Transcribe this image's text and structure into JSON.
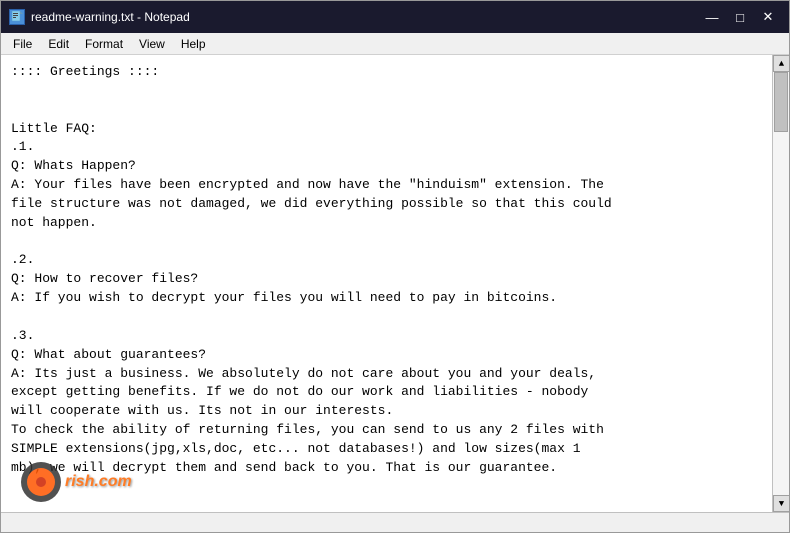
{
  "window": {
    "title": "readme-warning.txt - Notepad",
    "icon": "📄"
  },
  "titlebar": {
    "minimize_label": "—",
    "maximize_label": "□",
    "close_label": "✕"
  },
  "menubar": {
    "items": [
      "File",
      "Edit",
      "Format",
      "View",
      "Help"
    ]
  },
  "content": {
    "text": ":::: Greetings ::::\n\n\nLittle FAQ:\n.1.\nQ: Whats Happen?\nA: Your files have been encrypted and now have the \"hinduism\" extension. The\nfile structure was not damaged, we did everything possible so that this could\nnot happen.\n\n.2.\nQ: How to recover files?\nA: If you wish to decrypt your files you will need to pay in bitcoins.\n\n.3.\nQ: What about guarantees?\nA: Its just a business. We absolutely do not care about you and your deals,\nexcept getting benefits. If we do not do our work and liabilities - nobody\nwill cooperate with us. Its not in our interests.\nTo check the ability of returning files, you can send to us any 2 files with\nSIMPLE extensions(jpg,xls,doc, etc... not databases!) and low sizes(max 1\nmb), we will decrypt them and send back to you. That is our guarantee."
  },
  "watermark": {
    "text": "rish.com"
  }
}
